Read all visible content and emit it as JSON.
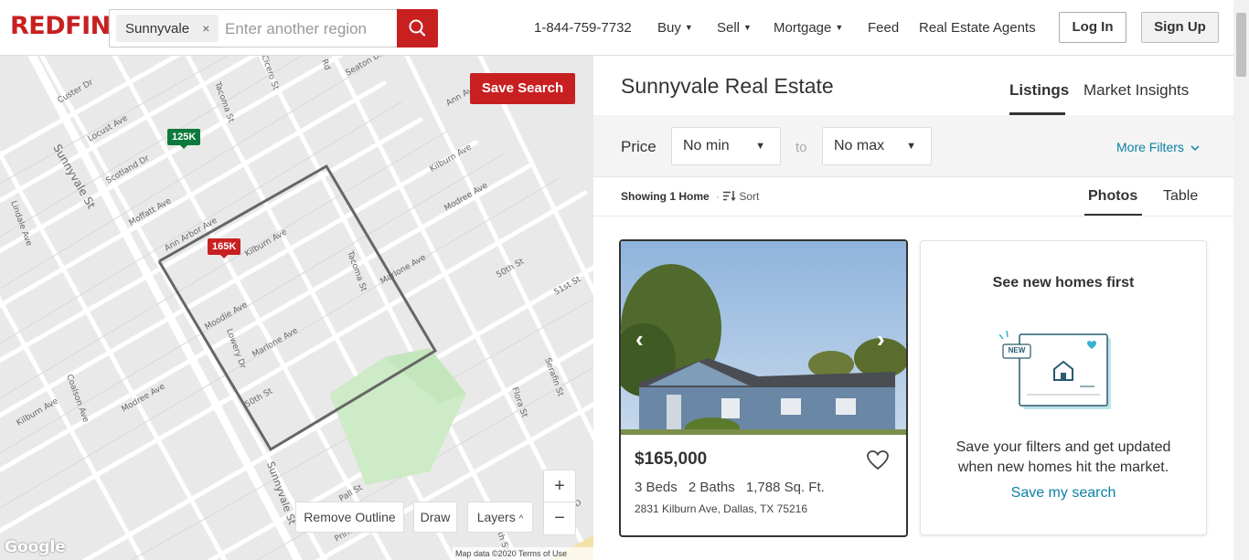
{
  "header": {
    "logo": "REDFIN",
    "search_chip": "Sunnyvale",
    "search_chip_remove": "×",
    "search_placeholder": "Enter another region",
    "phone": "1-844-759-7732",
    "nav": [
      {
        "label": "Buy",
        "has_caret": true
      },
      {
        "label": "Sell",
        "has_caret": true
      },
      {
        "label": "Mortgage",
        "has_caret": true
      },
      {
        "label": "Feed",
        "has_caret": false
      },
      {
        "label": "Real Estate Agents",
        "has_caret": false
      }
    ],
    "caret": "▼",
    "login": "Log In",
    "signup": "Sign Up"
  },
  "map": {
    "save_search": "Save Search",
    "pins": [
      {
        "label": "125K",
        "status": "sold"
      },
      {
        "label": "165K",
        "status": "active"
      }
    ],
    "street_labels": [
      "Sunnyvale St",
      "Custer Dr",
      "Locust Ave",
      "Scotland Dr",
      "Moffatt Ave",
      "Tacoma St",
      "Kilburn Ave",
      "Moodie Ave",
      "Marlone Ave",
      "Modree Ave",
      "Tacoma St",
      "Lindale Ave",
      "Coalson Ave",
      "Kilburn Ave",
      "Modree Ave",
      "50th St",
      "51st St",
      "Ann Arbor Ave",
      "Seaton Dr",
      "Kilburn Ave",
      "Modree Ave",
      "Marlone Ave",
      "Flora St",
      "Serafin St",
      "Sunnyvale St",
      "Corinth St",
      "Cicero St",
      "Rd",
      "Ann Ave",
      "Pall St",
      "Prince",
      "Lowery Dr"
    ],
    "buttons": {
      "remove_outline": "Remove Outline",
      "draw": "Draw",
      "layers": "Layers",
      "layers_caret": "^",
      "zoom_in": "+",
      "zoom_out": "−"
    },
    "google": "Google",
    "attribution": "Map data ©2020   Terms of Use"
  },
  "results": {
    "title": "Sunnyvale Real Estate",
    "tabs": [
      "Listings",
      "Market Insights"
    ],
    "active_tab": "Listings",
    "price_label": "Price",
    "min_price": "No min",
    "max_price": "No max",
    "to_label": "to",
    "more_filters": "More Filters",
    "showing": "Showing 1 Home",
    "separator": "·",
    "sort": "Sort",
    "view_tabs": [
      "Photos",
      "Table"
    ],
    "active_view": "Photos"
  },
  "listing": {
    "price": "$165,000",
    "beds": "3 Beds",
    "baths": "2 Baths",
    "sqft": "1,788 Sq. Ft.",
    "address": "2831 Kilburn Ave, Dallas, TX 75216",
    "prev_arrow": "‹",
    "next_arrow": "›"
  },
  "promo": {
    "title": "See new homes first",
    "badge": "NEW",
    "text": "Save your filters and get updated when new homes hit the market.",
    "link": "Save my search"
  },
  "colors": {
    "brand_red": "#c82021",
    "link_blue": "#0c82a5",
    "sold_green": "#0d7a3c"
  }
}
